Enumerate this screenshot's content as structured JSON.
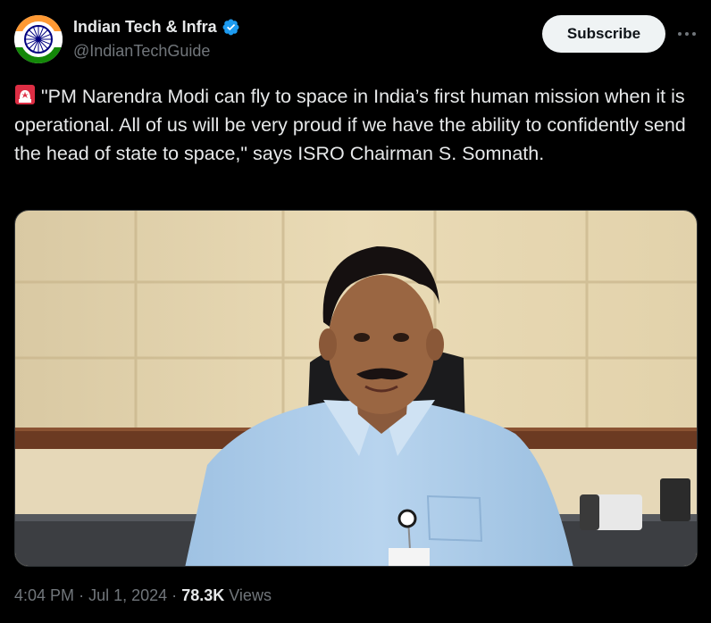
{
  "author": {
    "name": "Indian Tech & Infra",
    "handle": "@IndianTechGuide",
    "verified": true
  },
  "actions": {
    "subscribe_label": "Subscribe",
    "more_icon": "ellipsis-icon"
  },
  "post": {
    "emoji": "rotating-light-icon",
    "text": "\"PM Narendra Modi can fly to space in India’s first human mission when it is operational. All of us will be very proud if we have the ability to confidently send the head of state to space,\" says ISRO Chairman S. Somnath."
  },
  "meta": {
    "time": "4:04 PM",
    "separator": "·",
    "date": "Jul 1, 2024",
    "views_count": "78.3K",
    "views_label": "Views"
  },
  "colors": {
    "background": "#000000",
    "text": "#e7e9ea",
    "secondary": "#71767b",
    "verified": "#1d9bf0",
    "button_bg": "#eff3f4"
  }
}
